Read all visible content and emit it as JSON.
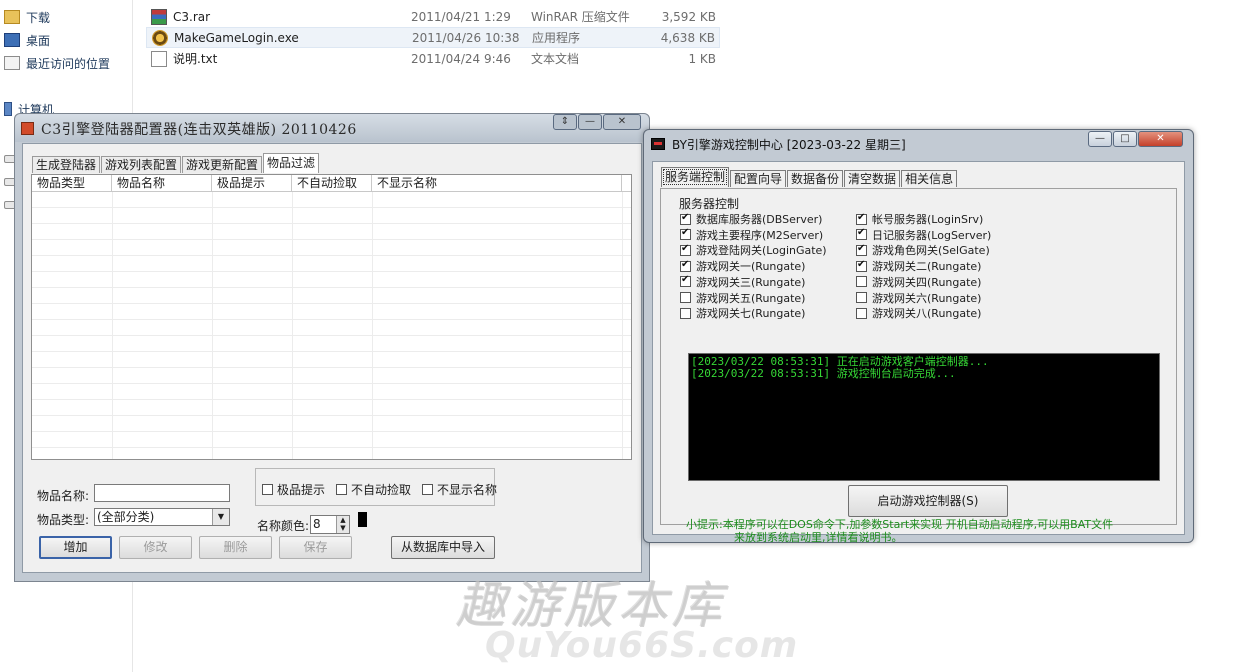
{
  "explorer": {
    "nav": [
      "下载",
      "桌面",
      "最近访问的位置",
      "计算机"
    ],
    "files": [
      {
        "name": "C3.rar",
        "date": "2011/04/21 1:29",
        "type": "WinRAR 压缩文件",
        "size": "3,592 KB"
      },
      {
        "name": "MakeGameLogin.exe",
        "date": "2011/04/26 10:38",
        "type": "应用程序",
        "size": "4,638 KB"
      },
      {
        "name": "说明.txt",
        "date": "2011/04/24 9:46",
        "type": "文本文档",
        "size": "1 KB"
      }
    ]
  },
  "config_window": {
    "title": "C3引擎登陆器配置器(连击双英雄版)  20110426",
    "controls": {
      "restore": "⇕",
      "minimize": "—",
      "close": "✕"
    },
    "tabs": [
      "生成登陆器",
      "游戏列表配置",
      "游戏更新配置",
      "物品过滤"
    ],
    "columns": [
      "物品类型",
      "物品名称",
      "极品提示",
      "不自动捡取",
      "不显示名称"
    ],
    "item_name_label": "物品名称:",
    "item_name_value": "",
    "item_type_label": "物品类型:",
    "item_type_value": "(全部分类)",
    "checkboxes": [
      "极品提示",
      "不自动捡取",
      "不显示名称"
    ],
    "name_color_label": "名称颜色:",
    "name_color_value": "8",
    "buttons": {
      "add": "增加",
      "edit": "修改",
      "delete": "删除",
      "save": "保存",
      "import": "从数据库中导入"
    }
  },
  "control_window": {
    "title": "BY引擎游戏控制中心 [2023-03-22 星期三]",
    "tabs": [
      "服务端控制",
      "配置向导",
      "数据备份",
      "清空数据",
      "相关信息"
    ],
    "group_title": "服务器控制",
    "services_left": [
      {
        "label": "数据库服务器(DBServer)",
        "checked": true
      },
      {
        "label": "游戏主要程序(M2Server)",
        "checked": true
      },
      {
        "label": "游戏登陆网关(LoginGate)",
        "checked": true
      },
      {
        "label": "游戏网关一(Rungate)",
        "checked": true
      },
      {
        "label": "游戏网关三(Rungate)",
        "checked": true
      },
      {
        "label": "游戏网关五(Rungate)",
        "checked": false
      },
      {
        "label": "游戏网关七(Rungate)",
        "checked": false
      }
    ],
    "services_right": [
      {
        "label": "帐号服务器(LoginSrv)",
        "checked": true
      },
      {
        "label": "日记服务器(LogServer)",
        "checked": true
      },
      {
        "label": "游戏角色网关(SelGate)",
        "checked": true
      },
      {
        "label": "游戏网关二(Rungate)",
        "checked": true
      },
      {
        "label": "游戏网关四(Rungate)",
        "checked": false
      },
      {
        "label": "游戏网关六(Rungate)",
        "checked": false
      },
      {
        "label": "游戏网关八(Rungate)",
        "checked": false
      }
    ],
    "log": [
      "[2023/03/22 08:53:31] 正在启动游戏客户端控制器...",
      "[2023/03/22 08:53:31] 游戏控制台启动完成..."
    ],
    "start_button": "启动游戏控制器(S)",
    "hint_line1": "小提示:本程序可以在DOS命令下,加参数Start来实现 开机自动启动程序,可以用BAT文件",
    "hint_line2": "来放到系统启动里,详情看说明书。",
    "log_color": "#36d836",
    "hint_color": "#1c8c1c"
  },
  "watermark": {
    "cn": "趣游版本库",
    "en": "QuYou66S.com"
  }
}
